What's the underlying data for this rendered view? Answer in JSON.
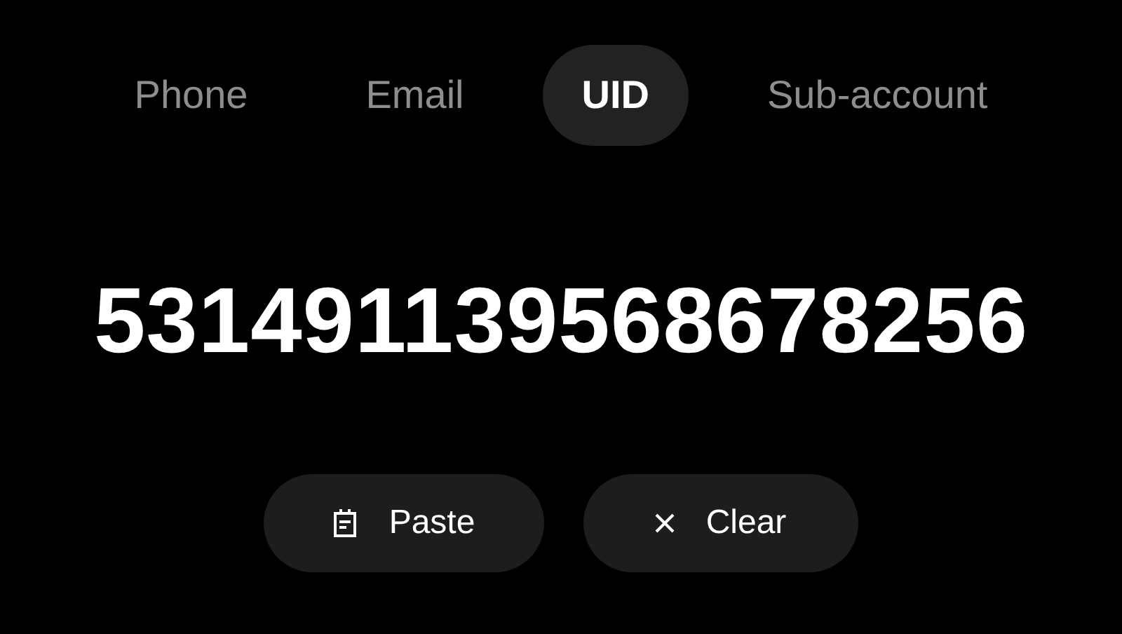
{
  "tabs": [
    {
      "label": "Phone",
      "selected": false
    },
    {
      "label": "Email",
      "selected": false
    },
    {
      "label": "UID",
      "selected": true
    },
    {
      "label": "Sub-account",
      "selected": false
    }
  ],
  "value": "531491139568678256",
  "buttons": [
    {
      "kind": "paste",
      "label": "Paste"
    },
    {
      "kind": "clear",
      "label": "Clear"
    }
  ]
}
